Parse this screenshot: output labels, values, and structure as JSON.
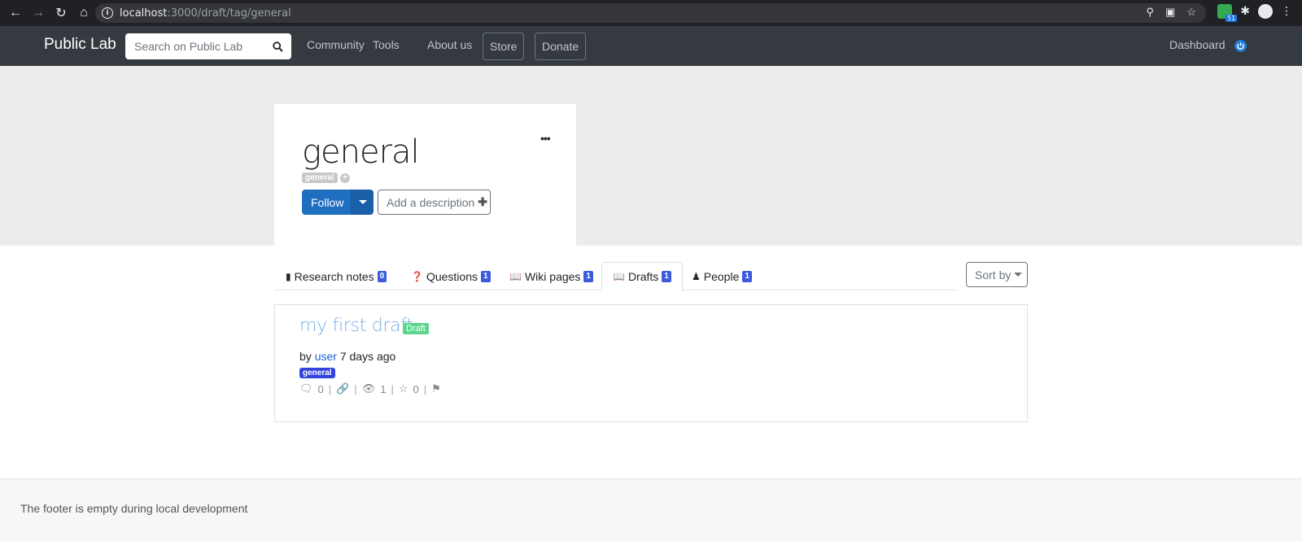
{
  "browser": {
    "url_host": "localhost",
    "url_rest": ":3000/draft/tag/general",
    "extension_badge": "51"
  },
  "navbar": {
    "brand": "Public Lab",
    "search_placeholder": "Search on Public Lab",
    "links": [
      "Community",
      "Tools",
      "About us"
    ],
    "store": "Store",
    "donate": "Donate",
    "dashboard": "Dashboard"
  },
  "tag_card": {
    "title": "general",
    "chip": "general",
    "follow": "Follow",
    "add_description": "Add a description",
    "menu": "•••"
  },
  "tabs": [
    {
      "label": "Research notes",
      "count": "0",
      "icon": "file-icon"
    },
    {
      "label": "Questions",
      "count": "1",
      "icon": "question-icon"
    },
    {
      "label": "Wiki pages",
      "count": "1",
      "icon": "book-icon"
    },
    {
      "label": "Drafts",
      "count": "1",
      "icon": "book-icon",
      "active": true
    },
    {
      "label": "People",
      "count": "1",
      "icon": "user-icon"
    }
  ],
  "sort_by": "Sort by",
  "draft": {
    "title": "my first draft",
    "status": "Draft",
    "by": "by",
    "author": "user",
    "time": "7 days ago",
    "tag": "general",
    "comments": "0",
    "views": "1",
    "stars": "0"
  },
  "footer": {
    "text": "The footer is empty during local development"
  },
  "colors": {
    "navbar": "#343a40",
    "primary": "#1f6fc1",
    "badge": "#3b5bdb",
    "draft_label": "#5cd68a"
  }
}
